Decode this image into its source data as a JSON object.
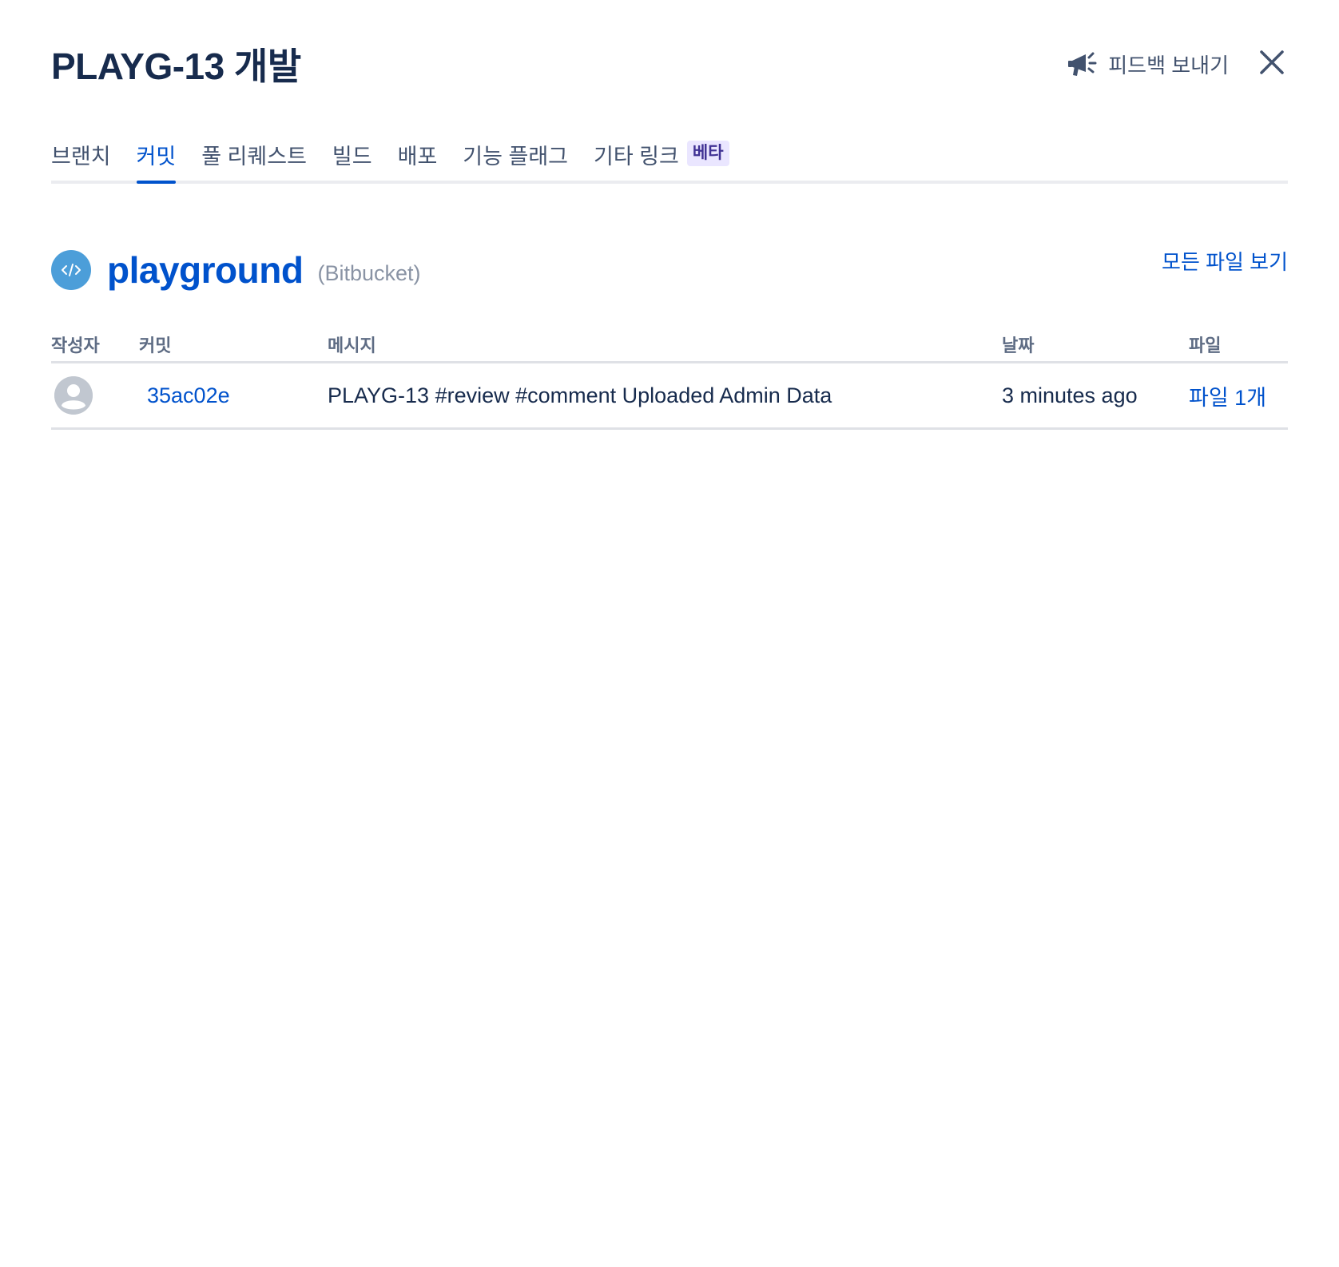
{
  "dialog": {
    "title": "PLAYG-13 개발",
    "feedback_label": "피드백 보내기"
  },
  "tabs": [
    {
      "label": "브랜치",
      "active": false
    },
    {
      "label": "커밋",
      "active": true
    },
    {
      "label": "풀 리퀘스트",
      "active": false
    },
    {
      "label": "빌드",
      "active": false
    },
    {
      "label": "배포",
      "active": false
    },
    {
      "label": "기능 플래그",
      "active": false
    },
    {
      "label": "기타 링크",
      "active": false,
      "badge": "베타"
    }
  ],
  "repo": {
    "name": "playground",
    "source": "(Bitbucket)",
    "view_all_files": "모든 파일 보기"
  },
  "table": {
    "headers": {
      "author": "작성자",
      "commit": "커밋",
      "message": "메시지",
      "date": "날짜",
      "files": "파일"
    },
    "rows": [
      {
        "commit": "35ac02e",
        "message": "PLAYG-13 #review #comment Uploaded Admin Data",
        "date": "3 minutes ago",
        "files": "파일 1개"
      }
    ]
  },
  "colors": {
    "primary": "#0052cc",
    "text": "#172b4d",
    "subtle": "#42526e",
    "muted": "#8993a4",
    "repo_icon": "#4c9ed9",
    "badge_bg": "#eae6ff",
    "badge_text": "#403294"
  },
  "icons": {
    "feedback": "megaphone-icon",
    "close": "close-icon",
    "repo": "code-icon",
    "avatar": "default-user-avatar-icon"
  }
}
